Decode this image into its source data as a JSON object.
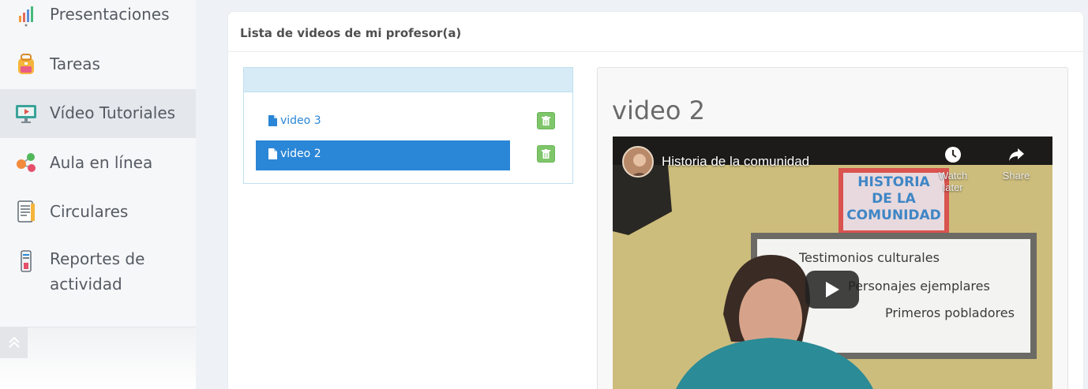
{
  "sidebar": {
    "items": [
      {
        "label": "Presentaciones",
        "icon": "chart-presentation-icon"
      },
      {
        "label": "Tareas",
        "icon": "backpack-icon"
      },
      {
        "label": "Vídeo Tutoriales",
        "icon": "video-monitor-icon",
        "active": true
      },
      {
        "label": "Aula en línea",
        "icon": "people-network-icon"
      },
      {
        "label": "Circulares",
        "icon": "document-icon"
      },
      {
        "label": "Reportes de",
        "label2": "actividad",
        "icon": "checklist-icon"
      }
    ],
    "scroll_top_icon": "double-chevron-up-icon"
  },
  "card": {
    "title": "Lista de videos de mi profesor(a)"
  },
  "videos": {
    "items": [
      {
        "label": "video 3",
        "active": false
      },
      {
        "label": "video 2",
        "active": true
      }
    ],
    "delete_icon": "trash-icon"
  },
  "preview": {
    "title": "video 2",
    "player": {
      "video_title": "Historia de la comunidad",
      "watch_later": "Watch later",
      "share": "Share",
      "poster_heading": [
        "HISTORIA",
        "DE LA",
        "COMUNIDAD"
      ],
      "board_lines": [
        "Testimonios culturales",
        "Personajes ejemplares",
        "Primeros pobladores"
      ]
    }
  },
  "colors": {
    "accent": "#2a86d6",
    "delete_green": "#7fc66a",
    "list_header": "#d6ebf6"
  }
}
